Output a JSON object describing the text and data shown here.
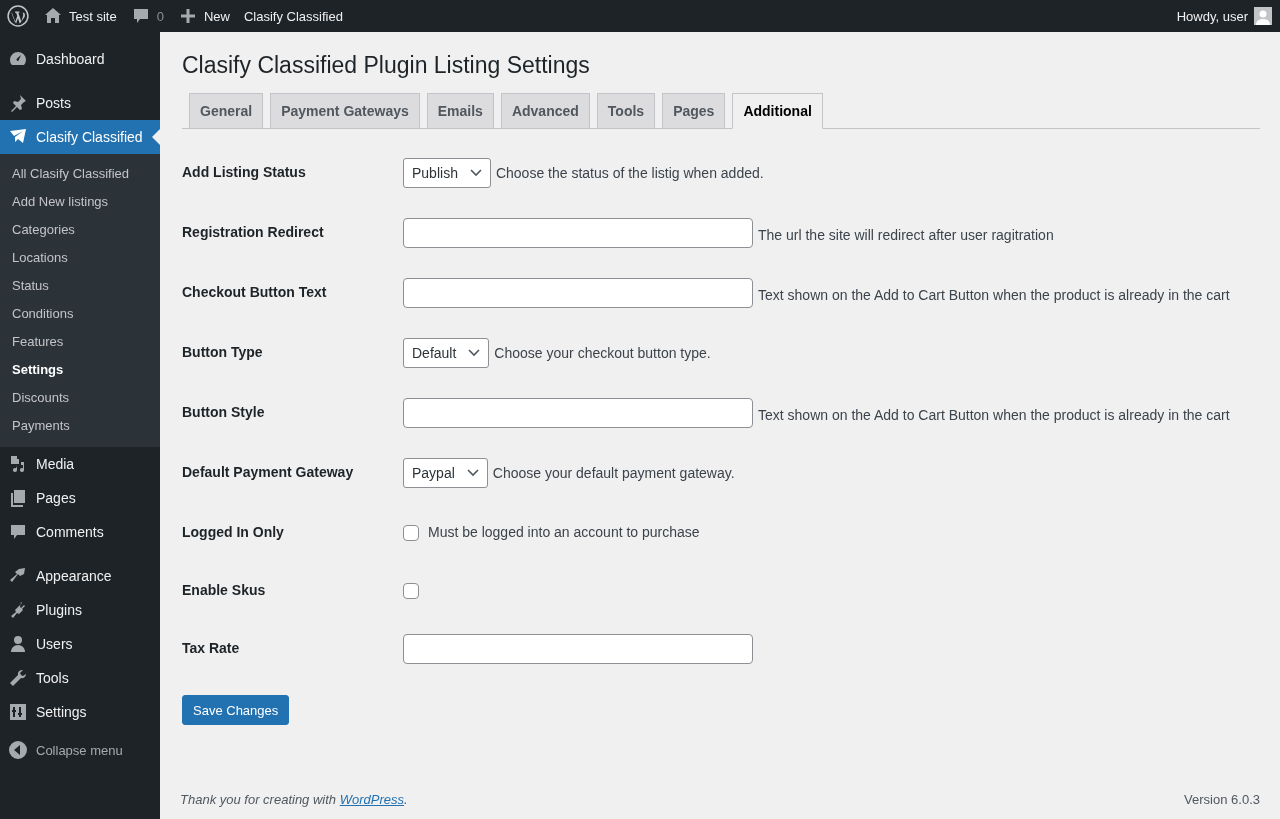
{
  "admin_bar": {
    "items": [
      {
        "kind": "logo"
      },
      {
        "kind": "home",
        "label": "Test site"
      },
      {
        "kind": "comments",
        "label": "0"
      },
      {
        "kind": "new",
        "label": "New"
      },
      {
        "kind": "text",
        "label": "Clasify Classified"
      }
    ],
    "greeting": "Howdy, user"
  },
  "sidebar": {
    "groups": [
      {
        "items": [
          {
            "label": "Dashboard",
            "selected": false
          }
        ]
      },
      {
        "items": [
          {
            "label": "Posts",
            "selected": false
          },
          {
            "label": "Clasify Classified",
            "selected": true,
            "children": [
              {
                "label": "All Clasify Classified",
                "selected": false
              },
              {
                "label": "Add New listings",
                "selected": false
              },
              {
                "label": "Categories",
                "selected": false
              },
              {
                "label": "Locations",
                "selected": false
              },
              {
                "label": "Status",
                "selected": false
              },
              {
                "label": "Conditions",
                "selected": false
              },
              {
                "label": "Features",
                "selected": false
              },
              {
                "label": "Settings",
                "selected": true
              },
              {
                "label": "Discounts",
                "selected": false
              },
              {
                "label": "Payments",
                "selected": false
              }
            ]
          },
          {
            "label": "Media",
            "selected": false
          },
          {
            "label": "Pages",
            "selected": false
          },
          {
            "label": "Comments",
            "selected": false
          }
        ]
      },
      {
        "items": [
          {
            "label": "Appearance",
            "selected": false
          },
          {
            "label": "Plugins",
            "selected": false
          },
          {
            "label": "Users",
            "selected": false
          },
          {
            "label": "Tools",
            "selected": false
          },
          {
            "label": "Settings",
            "selected": false
          }
        ]
      }
    ],
    "collapse": "Collapse menu"
  },
  "page": {
    "title": "Clasify Classified Plugin Listing Settings",
    "tabs": [
      {
        "label": "General",
        "selected": false
      },
      {
        "label": "Payment Gateways",
        "selected": false
      },
      {
        "label": "Emails",
        "selected": false
      },
      {
        "label": "Advanced",
        "selected": false
      },
      {
        "label": "Tools",
        "selected": false
      },
      {
        "label": "Pages",
        "selected": false
      },
      {
        "label": "Additional",
        "selected": true
      }
    ],
    "fields": [
      {
        "kind": "select",
        "label": "Add Listing Status",
        "value": "Publish",
        "description": "Choose the status of the listig when added."
      },
      {
        "kind": "text",
        "label": "Registration Redirect",
        "description": "The url the site will redirect after user ragitration"
      },
      {
        "kind": "text",
        "label": "Checkout Button Text",
        "description": "Text shown on the Add to Cart Button when the product is already in the cart"
      },
      {
        "kind": "select",
        "label": "Button Type",
        "value": "Default",
        "description": "Choose your checkout button type."
      },
      {
        "kind": "text",
        "label": "Button Style",
        "description": "Text shown on the Add to Cart Button when the product is already in the cart"
      },
      {
        "kind": "select",
        "label": "Default Payment Gateway",
        "value": "Paypal",
        "description": "Choose your default payment gateway."
      },
      {
        "kind": "checkbox",
        "label": "Logged In Only",
        "checked": false,
        "description": "Must be logged into an account to purchase"
      },
      {
        "kind": "checkbox",
        "label": "Enable Skus",
        "checked": false
      },
      {
        "kind": "text",
        "label": "Tax Rate"
      }
    ],
    "save_button": "Save Changes"
  },
  "footer": {
    "thanks": "Thank you for creating with",
    "link": "WordPress",
    "after": ".",
    "version": "Version 6.0.3"
  }
}
